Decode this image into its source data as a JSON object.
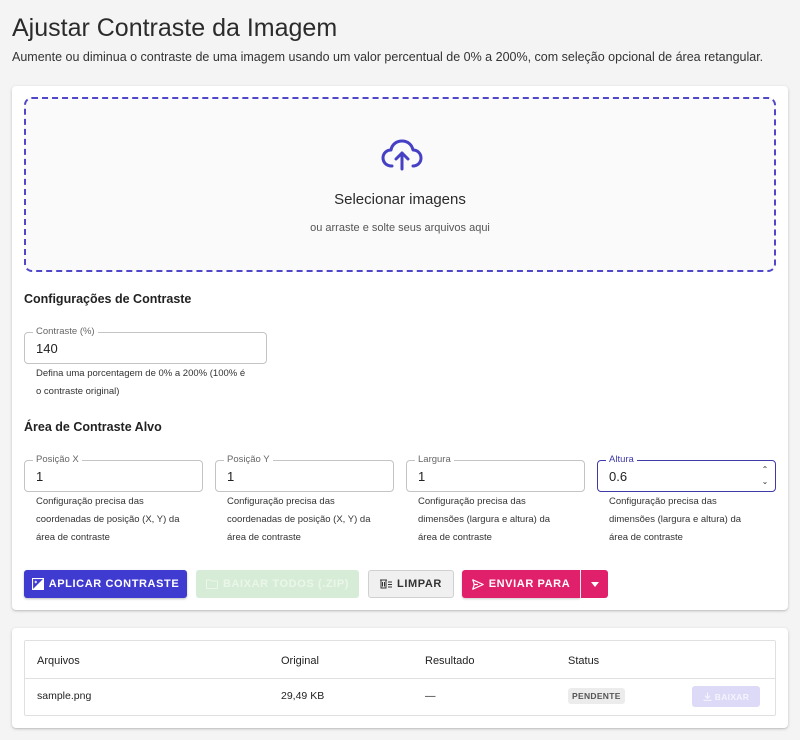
{
  "header": {
    "title": "Ajustar Contraste da Imagem",
    "subtitle": "Aumente ou diminua o contraste de uma imagem usando um valor percentual de 0% a 200%, com seleção opcional de área retangular."
  },
  "dropzone": {
    "icon": "cloud-upload-icon",
    "title": "Selecionar imagens",
    "subtitle": "ou arraste e solte seus arquivos aqui"
  },
  "contrast_settings": {
    "title": "Configurações de Contraste",
    "contrast_label": "Contraste (%)",
    "contrast_value": "140",
    "contrast_helper_line1": "Defina uma porcentagem de 0% a 200% (100% é",
    "contrast_helper_line2": "o contraste original)"
  },
  "target_area": {
    "title": "Área de Contraste Alvo",
    "fields": [
      {
        "label": "Posição X",
        "value": "1",
        "helper": [
          "Configuração precisa das",
          "coordenadas de posição (X, Y) da",
          "área de contraste"
        ]
      },
      {
        "label": "Posição Y",
        "value": "1",
        "helper": [
          "Configuração precisa das",
          "coordenadas de posição (X, Y) da",
          "área de contraste"
        ]
      },
      {
        "label": "Largura",
        "value": "1",
        "helper": [
          "Configuração precisa das",
          "dimensões (largura e altura) da",
          "área de contraste"
        ]
      },
      {
        "label": "Altura",
        "value": "0.6",
        "helper": [
          "Configuração precisa das",
          "dimensões (largura e altura) da",
          "área de contraste"
        ]
      }
    ]
  },
  "actions": {
    "apply": "APLICAR CONTRASTE",
    "download_all": "BAIXAR TODOS (.ZIP)",
    "clear": "LIMPAR",
    "send_to": "ENVIAR PARA"
  },
  "files_table": {
    "columns": [
      "Arquivos",
      "Original",
      "Resultado",
      "Status"
    ],
    "rows": [
      {
        "file": "sample.png",
        "original": "29,49 KB",
        "result": "—",
        "status": "PENDENTE",
        "action": "BAIXAR"
      }
    ]
  },
  "colors": {
    "primary": "#3f3ad0",
    "accent": "#e0206a",
    "success_disabled": "#d6ecd6",
    "dropzone_border": "#5048c8"
  }
}
